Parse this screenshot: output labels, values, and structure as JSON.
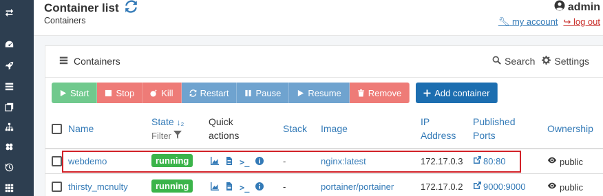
{
  "sidebar": {
    "icons": [
      "switch-endpoint-icon",
      "dashboard-icon",
      "app-templates-icon",
      "containers-icon",
      "images-icon",
      "networks-icon",
      "volumes-icon",
      "events-icon",
      "host-icon"
    ]
  },
  "header": {
    "title": "Container list",
    "breadcrumb": "Containers",
    "username": "admin",
    "my_account": "my account",
    "log_out": "log out"
  },
  "panel": {
    "title": "Containers",
    "search": "Search",
    "settings": "Settings"
  },
  "actions": {
    "start": "Start",
    "stop": "Stop",
    "kill": "Kill",
    "restart": "Restart",
    "pause": "Pause",
    "resume": "Resume",
    "remove": "Remove",
    "add": "Add container"
  },
  "table": {
    "headers": {
      "name": "Name",
      "state": "State",
      "filter": "Filter",
      "quick_actions_1": "Quick",
      "quick_actions_2": "actions",
      "stack": "Stack",
      "image": "Image",
      "ip_1": "IP",
      "ip_2": "Address",
      "ports_1": "Published",
      "ports_2": "Ports",
      "ownership": "Ownership"
    },
    "rows": [
      {
        "name": "webdemo",
        "state": "running",
        "stack": "-",
        "image": "nginx:latest",
        "ip": "172.17.0.3",
        "port": "80:80",
        "ownership": "public"
      },
      {
        "name": "thirsty_mcnulty",
        "state": "running",
        "stack": "-",
        "image": "portainer/portainer",
        "ip": "172.17.0.2",
        "port": "9000:9000",
        "ownership": "public"
      }
    ]
  },
  "colors": {
    "sidebar": "#2d3e50",
    "link": "#337ab7",
    "running": "#3bb44a",
    "highlight": "#d22128"
  }
}
